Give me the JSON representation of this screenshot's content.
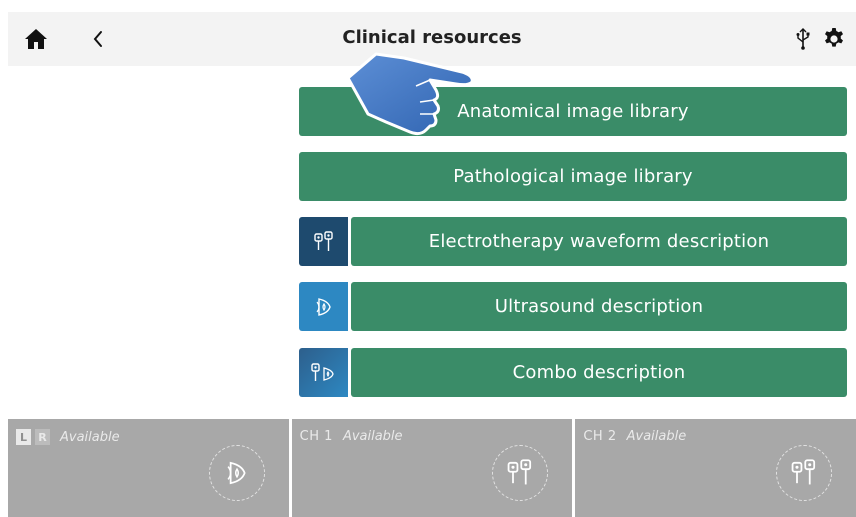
{
  "header": {
    "title": "Clinical resources",
    "icons": {
      "home": "home-icon",
      "back": "back-chevron-icon",
      "usb": "usb-icon",
      "settings": "gear-icon"
    }
  },
  "menu": [
    {
      "label": "Anatomical image library",
      "icon": null
    },
    {
      "label": "Pathological image library",
      "icon": null
    },
    {
      "label": "Electrotherapy waveform description",
      "icon": "electrotherapy-icon"
    },
    {
      "label": "Ultrasound description",
      "icon": "ultrasound-icon"
    },
    {
      "label": "Combo description",
      "icon": "combo-icon"
    }
  ],
  "channels": [
    {
      "left_tag": "L",
      "right_tag": "R",
      "status": "Available",
      "icon": "ultrasound-icon"
    },
    {
      "label": "CH 1",
      "status": "Available",
      "icon": "electrodes-icon"
    },
    {
      "label": "CH 2",
      "status": "Available",
      "icon": "electrodes-icon"
    }
  ],
  "colors": {
    "button_green": "#3a8c68",
    "tile_dark_blue": "#1e4a6e",
    "tile_blue": "#2d88c2",
    "panel_gray": "#a8a8a8",
    "header_bg": "#f3f3f3"
  },
  "overlay": {
    "icon": "pointing-hand-icon"
  }
}
